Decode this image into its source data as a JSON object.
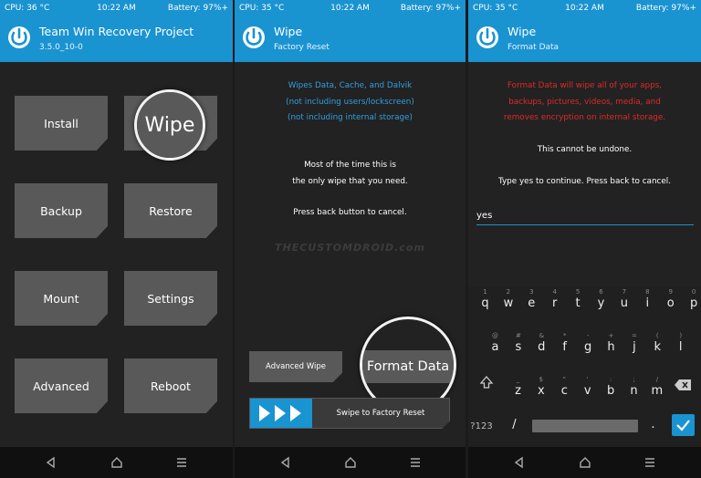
{
  "colors": {
    "accent": "#1a93d1",
    "button": "#595959",
    "background": "#222222",
    "warning_red": "#e02828",
    "info_blue": "#2f9fe0"
  },
  "screen1": {
    "status": {
      "cpu": "CPU: 36 °C",
      "time": "10:22 AM",
      "battery": "Battery: 97%+"
    },
    "header": {
      "title": "Team Win Recovery Project",
      "subtitle": "3.5.0_10-0"
    },
    "buttons": {
      "install": "Install",
      "wipe": "Wipe",
      "backup": "Backup",
      "restore": "Restore",
      "mount": "Mount",
      "settings": "Settings",
      "advanced": "Advanced",
      "reboot": "Reboot"
    },
    "icons": {
      "logo": "twrp-logo-icon",
      "back": "back-icon",
      "home": "home-icon",
      "menu": "menu-icon"
    }
  },
  "screen2": {
    "status": {
      "cpu": "CPU: 35 °C",
      "time": "10:22 AM",
      "battery": "Battery: 97%+"
    },
    "header": {
      "title": "Wipe",
      "subtitle": "Factory Reset"
    },
    "info_lines": [
      "Wipes Data, Cache, and Dalvik",
      "(not including users/lockscreen)",
      "(not including internal storage)"
    ],
    "note_lines": [
      "Most of the time this is",
      "the only wipe that you need."
    ],
    "cancel_hint": "Press back button to cancel.",
    "watermark": "THECUSTOMDROID.com",
    "advanced_wipe": "Advanced Wipe",
    "format_data": "Format Data",
    "swipe_label": "Swipe to Factory Reset"
  },
  "screen3": {
    "status": {
      "cpu": "CPU: 35 °C",
      "time": "10:22 AM",
      "battery": "Battery: 97%+"
    },
    "header": {
      "title": "Wipe",
      "subtitle": "Format Data"
    },
    "warning_lines": [
      "Format Data will wipe all of your apps,",
      "backups, pictures, videos, media, and",
      "removes encryption on internal storage."
    ],
    "undone": "This cannot be undone.",
    "prompt": "Type yes to continue.  Press back to cancel.",
    "input_value": "yes",
    "keyboard": {
      "row1": [
        {
          "h": "1",
          "k": "q"
        },
        {
          "h": "2",
          "k": "w"
        },
        {
          "h": "3",
          "k": "e"
        },
        {
          "h": "4",
          "k": "r"
        },
        {
          "h": "5",
          "k": "t"
        },
        {
          "h": "6",
          "k": "y"
        },
        {
          "h": "7",
          "k": "u"
        },
        {
          "h": "8",
          "k": "i"
        },
        {
          "h": "9",
          "k": "o"
        },
        {
          "h": "0",
          "k": "p"
        }
      ],
      "row2": [
        {
          "h": "@",
          "k": "a"
        },
        {
          "h": "#",
          "k": "s"
        },
        {
          "h": "&",
          "k": "d"
        },
        {
          "h": "*",
          "k": "f"
        },
        {
          "h": "-",
          "k": "g"
        },
        {
          "h": "+",
          "k": "h"
        },
        {
          "h": "=",
          "k": "j"
        },
        {
          "h": "(",
          "k": "k"
        },
        {
          "h": ")",
          "k": "l"
        }
      ],
      "row3": [
        {
          "h": "_",
          "k": "z"
        },
        {
          "h": "$",
          "k": "x"
        },
        {
          "h": "\"",
          "k": "c"
        },
        {
          "h": "'",
          "k": "v"
        },
        {
          "h": ":",
          "k": "b"
        },
        {
          "h": ";",
          "k": "n"
        },
        {
          "h": "/",
          "k": "m"
        }
      ],
      "symbols": "?123",
      "slash": "/",
      "period": "."
    }
  }
}
